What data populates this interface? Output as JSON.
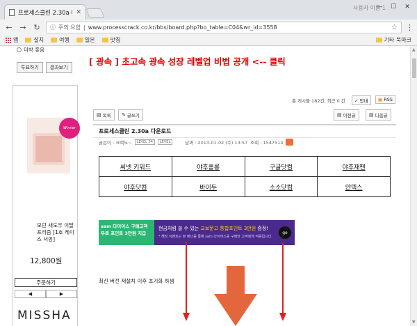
{
  "browser": {
    "tab_title": "프로세스클린 2.30a 다운로드",
    "user_label": "사용자 이름 1",
    "warning_text": "주의 요함",
    "url": "www.processcrack.co.kr/bbs/board.php?bo_table=C04&wr_id=3558",
    "bookmarks": [
      "앱",
      "설치",
      "여행",
      "일본",
      "맛집"
    ],
    "other_bookmarks": "기타 북마크"
  },
  "poll": {
    "option": "미박 좋음",
    "vote_label": "투표하기",
    "results_label": "결과보기"
  },
  "ad": {
    "badge": "Winner",
    "product_name": "모던 새도우 이탈 프리즘 [1호 레이스 서핑]",
    "price": "12,800원",
    "buy_label": "주문하기",
    "prev": "◀",
    "next": "▶",
    "brand": "MISSHA"
  },
  "headline": "[ 광속 ] 초고속 광속 성장 레벨업 비법 공개 <-- 클릭",
  "board": {
    "stats": "총 게시물 182건, 최근 0 건",
    "guide_label": "안내",
    "rss_label": "RSS",
    "list_label": "목록",
    "write_label": "글쓰기",
    "prev_post_label": "이전글",
    "next_post_label": "다음글",
    "post_title": "프로세스클린 2.30a 다운로드",
    "meta_author": "글쓴이 : 크랙도~",
    "meta_level1": "LEVEL 34",
    "meta_level2": "LEVEL",
    "meta_date": "날짜 : 2013-01-02 (수) 13:57",
    "meta_views": "조회 : 1547514"
  },
  "links": [
    [
      "씨넷 키워드",
      "야후홀롱",
      "구글닷컴",
      "야후재팬"
    ],
    [
      "야후닷컴",
      "바이두",
      "소소닷컴",
      "얀덱스"
    ]
  ],
  "banner": {
    "left": "sam 다이어스 구매고객 무료 포인트 3만원 지급",
    "main_prefix": "현금처럼 쓸 수 있는 ",
    "main_highlight": "교보문고 통합포인트 3만원",
    "main_suffix": " 증정!",
    "sub": "* 해당 이벤트는 본 배너를 통해 sam 다이어스를 구매한 고객에게 적용됩니다.",
    "go": "go"
  },
  "note": "최신 버전 재설치 이후 초기화 하셈"
}
